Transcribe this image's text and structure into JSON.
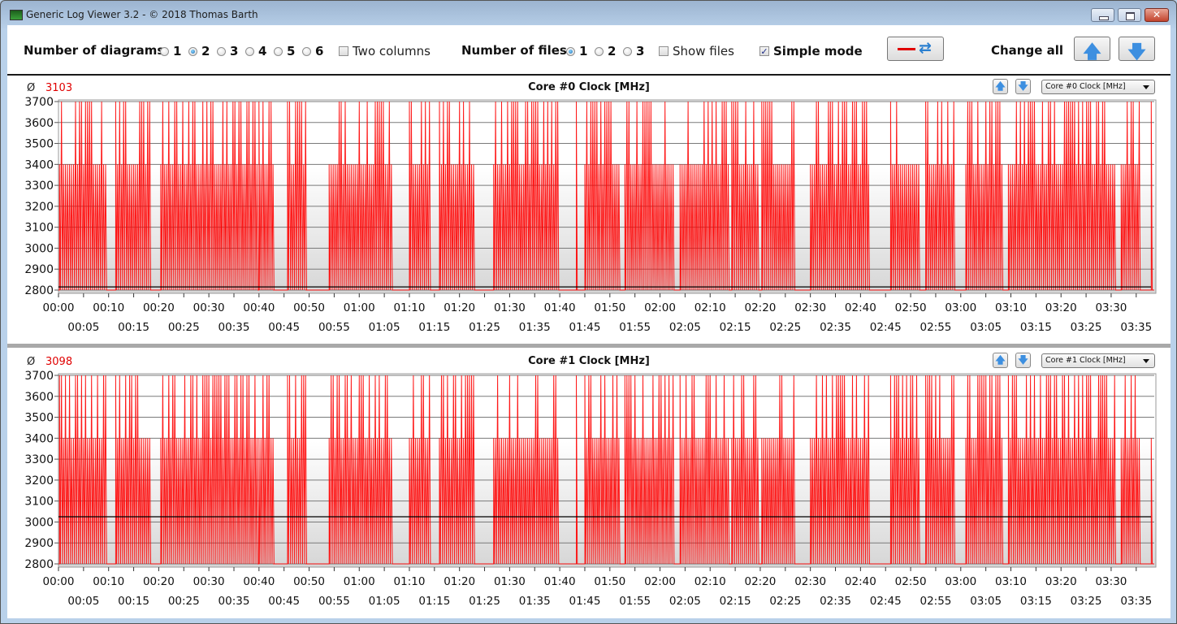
{
  "window": {
    "title": "Generic Log Viewer 3.2 - © 2018 Thomas Barth",
    "buttons": [
      "minimize",
      "maximize",
      "close"
    ]
  },
  "toolbar": {
    "num_diagrams_label": "Number of diagrams",
    "num_diagrams_options": [
      "1",
      "2",
      "3",
      "4",
      "5",
      "6"
    ],
    "num_diagrams_selected": "2",
    "two_columns_label": "Two columns",
    "two_columns_checked": false,
    "num_files_label": "Number of files",
    "num_files_options": [
      "1",
      "2",
      "3"
    ],
    "num_files_selected": "1",
    "show_files_label": "Show files",
    "show_files_checked": false,
    "simple_mode_label": "Simple mode",
    "simple_mode_checked": true,
    "change_all_label": "Change all",
    "line_color": "#e00000"
  },
  "panels": [
    {
      "avg_symbol": "Ø",
      "avg_value": "3103",
      "title": "Core #0 Clock [MHz]",
      "select_value": "Core #0 Clock [MHz]",
      "ref_line": 2815
    },
    {
      "avg_symbol": "Ø",
      "avg_value": "3098",
      "title": "Core #1 Clock [MHz]",
      "select_value": "Core #1 Clock [MHz]",
      "ref_line": 3025
    }
  ],
  "chart_data": [
    {
      "type": "line",
      "title": "Core #0 Clock [MHz]",
      "xlabel": "",
      "ylabel": "",
      "ylim": [
        2800,
        3700
      ],
      "xlim_minutes": [
        0,
        218.6
      ],
      "yticks": [
        "3700",
        "3600",
        "3500",
        "3400",
        "3300",
        "3200",
        "3100",
        "3000",
        "2900",
        "2800"
      ],
      "xticks_top": [
        "00:00",
        "00:10",
        "00:20",
        "00:30",
        "00:40",
        "00:50",
        "01:00",
        "01:10",
        "01:20",
        "01:30",
        "01:40",
        "01:50",
        "02:00",
        "02:10",
        "02:20",
        "02:30",
        "02:40",
        "02:50",
        "03:00",
        "03:10",
        "03:20",
        "03:30"
      ],
      "xticks_bottom": [
        "00:05",
        "00:15",
        "00:25",
        "00:35",
        "00:45",
        "00:55",
        "01:05",
        "01:15",
        "01:25",
        "01:35",
        "01:45",
        "01:55",
        "02:05",
        "02:15",
        "02:25",
        "02:35",
        "02:45",
        "02:55",
        "03:05",
        "03:15",
        "03:25",
        "03:35"
      ],
      "grid": true,
      "baseline": 2800,
      "spike_levels": [
        3400,
        3700
      ],
      "bursts_minutes": [
        [
          0.2,
          9.7
        ],
        [
          11.4,
          18.5
        ],
        [
          20.4,
          39.7
        ],
        [
          40,
          42.8
        ],
        [
          45.7,
          49.3
        ],
        [
          54,
          66.6
        ],
        [
          70,
          74.4
        ],
        [
          76,
          82.9
        ],
        [
          86.8,
          99.7
        ],
        [
          103.3,
          103.5
        ],
        [
          105,
          112
        ],
        [
          113,
          123
        ],
        [
          124,
          134
        ],
        [
          134.3,
          139.6
        ],
        [
          140.3,
          147
        ],
        [
          150,
          162
        ],
        [
          166,
          172
        ],
        [
          173,
          179
        ],
        [
          181,
          188.6
        ],
        [
          189.5,
          211
        ],
        [
          212,
          216
        ],
        [
          218,
          218.3
        ]
      ],
      "series": [
        {
          "name": "Core #0 Clock [MHz]",
          "color": "#ff0000",
          "average": 3103
        }
      ]
    },
    {
      "type": "line",
      "title": "Core #1 Clock [MHz]",
      "xlabel": "",
      "ylabel": "",
      "ylim": [
        2800,
        3700
      ],
      "xlim_minutes": [
        0,
        218.6
      ],
      "yticks": [
        "3700",
        "3600",
        "3500",
        "3400",
        "3300",
        "3200",
        "3100",
        "3000",
        "2900",
        "2800"
      ],
      "xticks_top": [
        "00:00",
        "00:10",
        "00:20",
        "00:30",
        "00:40",
        "00:50",
        "01:00",
        "01:10",
        "01:20",
        "01:30",
        "01:40",
        "01:50",
        "02:00",
        "02:10",
        "02:20",
        "02:30",
        "02:40",
        "02:50",
        "03:00",
        "03:10",
        "03:20",
        "03:30"
      ],
      "xticks_bottom": [
        "00:05",
        "00:15",
        "00:25",
        "00:35",
        "00:45",
        "00:55",
        "01:05",
        "01:15",
        "01:25",
        "01:35",
        "01:45",
        "01:55",
        "02:05",
        "02:15",
        "02:25",
        "02:35",
        "02:45",
        "02:55",
        "03:05",
        "03:15",
        "03:25",
        "03:35"
      ],
      "grid": true,
      "baseline": 2800,
      "spike_levels": [
        3400,
        3700
      ],
      "bursts_minutes": [
        [
          0.2,
          9.7
        ],
        [
          11.4,
          18.5
        ],
        [
          20.4,
          39.7
        ],
        [
          40,
          42.8
        ],
        [
          45.7,
          49.3
        ],
        [
          54,
          66.6
        ],
        [
          70,
          74.4
        ],
        [
          76,
          82.9
        ],
        [
          86.8,
          99.7
        ],
        [
          103.3,
          103.5
        ],
        [
          105,
          112
        ],
        [
          113,
          123
        ],
        [
          124,
          134
        ],
        [
          134.3,
          139.6
        ],
        [
          140.3,
          147
        ],
        [
          150,
          162
        ],
        [
          166,
          172
        ],
        [
          173,
          179
        ],
        [
          181,
          188.6
        ],
        [
          189.5,
          211
        ],
        [
          212,
          216
        ],
        [
          218,
          218.3
        ]
      ],
      "series": [
        {
          "name": "Core #1 Clock [MHz]",
          "color": "#ff0000",
          "average": 3098
        }
      ]
    }
  ]
}
